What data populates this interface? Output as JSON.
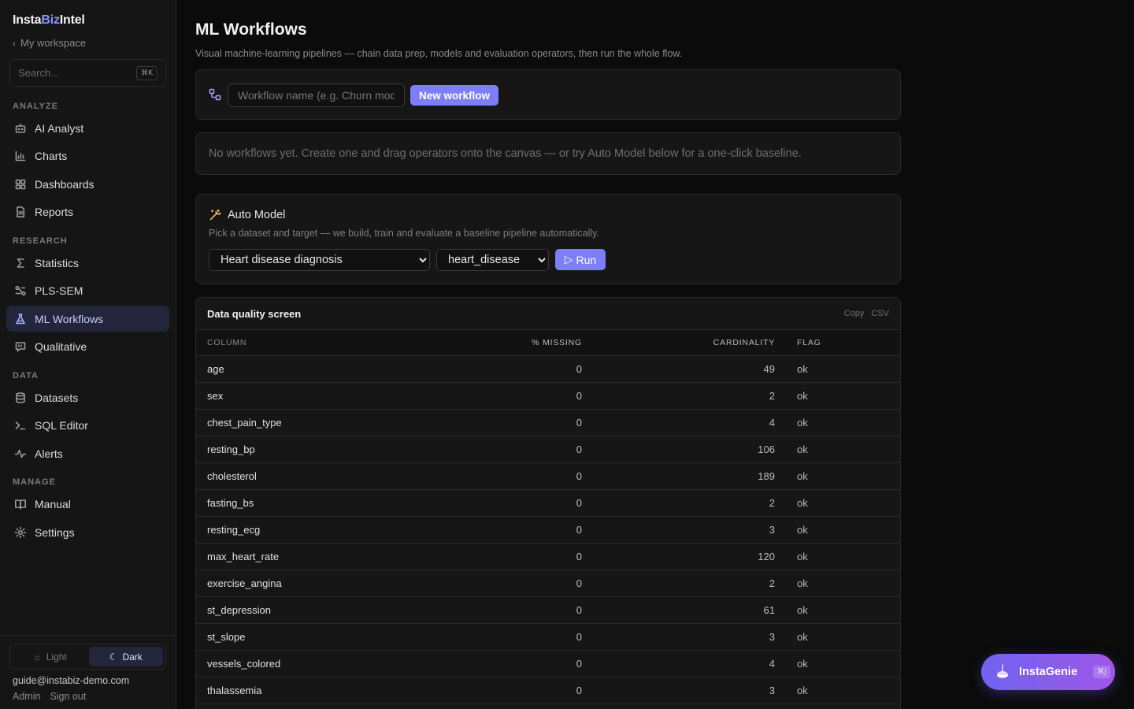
{
  "sidebar": {
    "brand_a": "Insta",
    "brand_b": "Biz",
    "brand_c": "Intel",
    "back_label": "My workspace",
    "search_placeholder": "Search...",
    "search_kbd": "⌘K",
    "sections": {
      "analyze": "ANALYZE",
      "research": "RESEARCH",
      "data": "DATA",
      "manage": "MANAGE"
    },
    "items": {
      "ai_analyst": "AI Analyst",
      "charts": "Charts",
      "dashboards": "Dashboards",
      "reports": "Reports",
      "statistics": "Statistics",
      "pls_sem": "PLS-SEM",
      "ml_workflows": "ML Workflows",
      "qualitative": "Qualitative",
      "datasets": "Datasets",
      "sql_editor": "SQL Editor",
      "alerts": "Alerts",
      "manual": "Manual",
      "settings": "Settings"
    },
    "theme": {
      "light": "Light",
      "dark": "Dark"
    },
    "user_email": "guide@instabiz-demo.com",
    "admin_label": "Admin",
    "signout_label": "Sign out"
  },
  "main": {
    "title": "ML Workflows",
    "subtitle": "Visual machine-learning pipelines — chain data prep, models and evaluation operators, then run the whole flow.",
    "workflow_placeholder": "Workflow name (e.g. Churn model)",
    "new_workflow_label": "New workflow",
    "empty_text": "No workflows yet. Create one and drag operators onto the canvas — or try Auto Model below for a one-click baseline.",
    "auto_model": {
      "title": "Auto Model",
      "subtitle": "Pick a dataset and target — we build, train and evaluate a baseline pipeline automatically.",
      "dataset": "Heart disease diagnosis",
      "target": "heart_disease",
      "run_label": "Run"
    },
    "dq": {
      "title": "Data quality screen",
      "copy_label": "Copy",
      "csv_label": "CSV",
      "headers": {
        "column": "COLUMN",
        "missing": "% MISSING",
        "cardinality": "CARDINALITY",
        "flag": "FLAG"
      },
      "rows": [
        {
          "column": "age",
          "missing": "0",
          "cardinality": "49",
          "flag": "ok"
        },
        {
          "column": "sex",
          "missing": "0",
          "cardinality": "2",
          "flag": "ok"
        },
        {
          "column": "chest_pain_type",
          "missing": "0",
          "cardinality": "4",
          "flag": "ok"
        },
        {
          "column": "resting_bp",
          "missing": "0",
          "cardinality": "106",
          "flag": "ok"
        },
        {
          "column": "cholesterol",
          "missing": "0",
          "cardinality": "189",
          "flag": "ok"
        },
        {
          "column": "fasting_bs",
          "missing": "0",
          "cardinality": "2",
          "flag": "ok"
        },
        {
          "column": "resting_ecg",
          "missing": "0",
          "cardinality": "3",
          "flag": "ok"
        },
        {
          "column": "max_heart_rate",
          "missing": "0",
          "cardinality": "120",
          "flag": "ok"
        },
        {
          "column": "exercise_angina",
          "missing": "0",
          "cardinality": "2",
          "flag": "ok"
        },
        {
          "column": "st_depression",
          "missing": "0",
          "cardinality": "61",
          "flag": "ok"
        },
        {
          "column": "st_slope",
          "missing": "0",
          "cardinality": "3",
          "flag": "ok"
        },
        {
          "column": "vessels_colored",
          "missing": "0",
          "cardinality": "4",
          "flag": "ok"
        },
        {
          "column": "thalassemia",
          "missing": "0",
          "cardinality": "3",
          "flag": "ok"
        }
      ]
    }
  },
  "genie": {
    "label": "InstaGenie",
    "kbd": "⌘J"
  },
  "colors": {
    "accent": "#7c7ff7",
    "active_nav_bg": "#23253a",
    "background": "#0b0b0b",
    "sidebar_bg": "#151515"
  }
}
